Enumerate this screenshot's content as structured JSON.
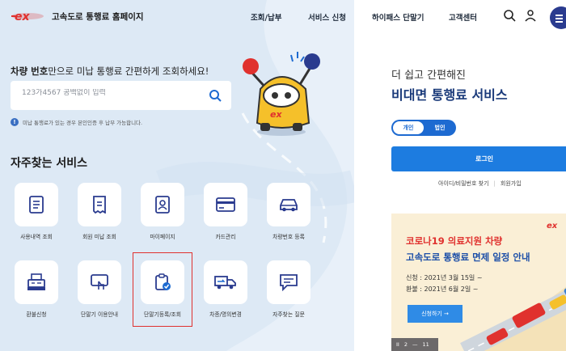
{
  "header": {
    "logo_text": "고속도로 통행료 홈페이지",
    "nav": [
      "조회/납부",
      "서비스 신청",
      "하이패스 단말기",
      "고객센터"
    ]
  },
  "search": {
    "title_bold": "차량 번호",
    "title_rest": "만으로 미납 통행료 간편하게 조회하세요!",
    "placeholder": "123가4567 공백없이 입력",
    "notice": "미납 통행료가 있는 경우 본인인증 후 납부 가능합니다."
  },
  "frequent": {
    "title": "자주찾는 서비스",
    "items": [
      {
        "label": "사용내역 조회",
        "icon": "receipt-list-icon"
      },
      {
        "label": "회원 미납 조회",
        "icon": "bill-icon"
      },
      {
        "label": "마이페이지",
        "icon": "profile-card-icon"
      },
      {
        "label": "카드관리",
        "icon": "credit-card-icon"
      },
      {
        "label": "차량번호 등록",
        "icon": "car-icon"
      },
      {
        "label": "환불신청",
        "icon": "cash-register-icon"
      },
      {
        "label": "단말기 이용안내",
        "icon": "touch-screen-icon"
      },
      {
        "label": "단말기등록/조회",
        "icon": "device-check-icon"
      },
      {
        "label": "차종/명의변경",
        "icon": "truck-change-icon"
      },
      {
        "label": "자주찾는 질문",
        "icon": "chat-bubble-icon"
      }
    ]
  },
  "account": {
    "promo_line1": "더 쉽고 간편해진",
    "promo_line2": "비대면 통행료 서비스",
    "toggle_personal": "개인",
    "toggle_corporate": "법인",
    "login": "로그인",
    "find_id": "아이디/비밀번호 찾기",
    "signup": "회원가입"
  },
  "banner": {
    "title1": "코로나19 의료지원 차량",
    "title2": "고속도로 통행료 면제 일정 안내",
    "apply": "신청 : 2021년 3월 15일 ~",
    "refund": "환불 : 2021년 6월 2일 ~",
    "button": "신청하기 →",
    "page_current": "2",
    "page_total": "11",
    "pause": "II",
    "mini_logo": "한국도로공사"
  },
  "colors": {
    "brand_red": "#e0312e",
    "brand_blue": "#1d7ce0",
    "navy": "#1a3a7a",
    "panel_bg": "#dde9f5"
  }
}
